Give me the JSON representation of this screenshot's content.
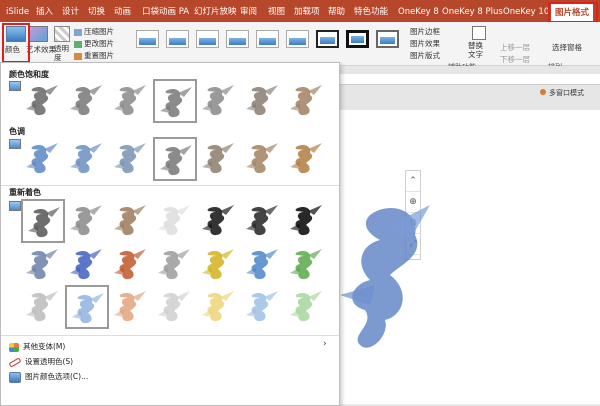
{
  "ribbon_tabs": [
    "iSlide",
    "插入",
    "设计",
    "切换",
    "动画",
    "口袋动画 PA",
    "幻灯片放映",
    "审阅",
    "视图",
    "加载项",
    "帮助",
    "特色功能",
    "OneKey 8",
    "OneKey 8 Plus",
    "OneKey 10",
    "图片格式"
  ],
  "ribbon": {
    "color_label": "颜色",
    "art_effect": "艺术效果",
    "transparency": "透明度",
    "compress": "压缩图片",
    "change_picture": "更改图片",
    "reset_picture": "重置图片",
    "picture_border": "图片边框",
    "picture_effects": "图片效果",
    "picture_layout": "图片版式",
    "alt_text": "替换文字",
    "accessibility": "辅助功能",
    "bring_forward": "上移一层",
    "send_backward": "下移一层",
    "selection_pane": "选择窗格",
    "arrange": "排列",
    "multi_window": "多窗口模式"
  },
  "dropdown": {
    "sections": [
      "颜色饱和度",
      "色调",
      "重新着色"
    ],
    "menu_items": [
      "其他变体(M)",
      "设置透明色(S)",
      "图片颜色选项(C)..."
    ]
  },
  "colors": {
    "accent": "#b7472a",
    "highlight_box": "#e0201c"
  }
}
